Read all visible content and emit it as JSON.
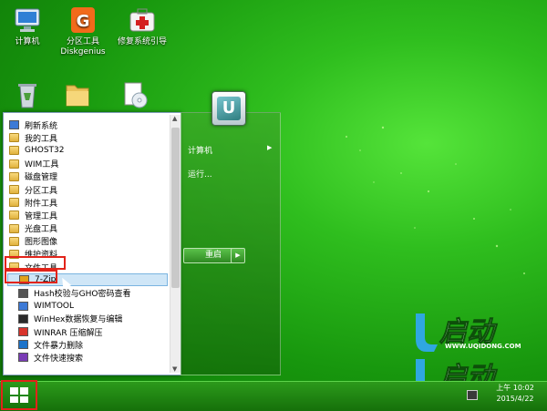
{
  "desktop": {
    "icons": [
      {
        "label": "计算机",
        "icon": "computer-icon"
      },
      {
        "label": "分区工具\nDiskgenius",
        "icon": "diskgenius-icon"
      },
      {
        "label": "修复系统引导",
        "icon": "repair-boot-icon"
      },
      {
        "label": "",
        "icon": "recycle-bin-icon"
      },
      {
        "label": "",
        "icon": "folder-icon"
      },
      {
        "label": "",
        "icon": "cd-document-icon"
      }
    ]
  },
  "start_menu": {
    "programs": [
      {
        "label": "刷新系统",
        "icon": "refresh-icon",
        "kind": "app"
      },
      {
        "label": "我的工具",
        "icon": "folder-icon",
        "kind": "folder"
      },
      {
        "label": "GHOST32",
        "icon": "folder-icon",
        "kind": "folder"
      },
      {
        "label": "WIM工具",
        "icon": "folder-icon",
        "kind": "folder"
      },
      {
        "label": "磁盘管理",
        "icon": "folder-icon",
        "kind": "folder"
      },
      {
        "label": "分区工具",
        "icon": "folder-icon",
        "kind": "folder"
      },
      {
        "label": "附件工具",
        "icon": "folder-icon",
        "kind": "folder"
      },
      {
        "label": "管理工具",
        "icon": "folder-icon",
        "kind": "folder"
      },
      {
        "label": "光盘工具",
        "icon": "folder-icon",
        "kind": "folder"
      },
      {
        "label": "图形图像",
        "icon": "folder-icon",
        "kind": "folder"
      },
      {
        "label": "维护资料",
        "icon": "folder-icon",
        "kind": "folder"
      },
      {
        "label": "文件工具",
        "icon": "folder-icon",
        "kind": "folder",
        "highlighted": true
      },
      {
        "label": "7-Zip",
        "icon": "7zip-icon",
        "kind": "app",
        "child": true,
        "selected": true
      },
      {
        "label": "Hash校验与GHO密码查看",
        "icon": "hash-icon",
        "kind": "app",
        "child": true
      },
      {
        "label": "WIMTOOL",
        "icon": "wimtool-icon",
        "kind": "app",
        "child": true
      },
      {
        "label": "WinHex数据恢复与编辑",
        "icon": "winhex-icon",
        "kind": "app",
        "child": true
      },
      {
        "label": "WINRAR 压缩解压",
        "icon": "winrar-icon",
        "kind": "app",
        "child": true
      },
      {
        "label": "文件暴力删除",
        "icon": "force-delete-icon",
        "kind": "app",
        "child": true
      },
      {
        "label": "文件快速搜索",
        "icon": "file-search-icon",
        "kind": "app",
        "child": true
      }
    ],
    "right": {
      "computer": "计算机",
      "run": "运行...",
      "restart": "重启"
    }
  },
  "branding": {
    "logo_text": "U启动",
    "logo_url": "WWW.UQIDONG.COM"
  },
  "taskbar": {
    "time": "上午 10:02",
    "date": "2015/4/22"
  },
  "colors": {
    "desktop_green": "#2fbe1e",
    "highlight_red": "#e2241a",
    "selection_blue": "#cfe6f7"
  }
}
